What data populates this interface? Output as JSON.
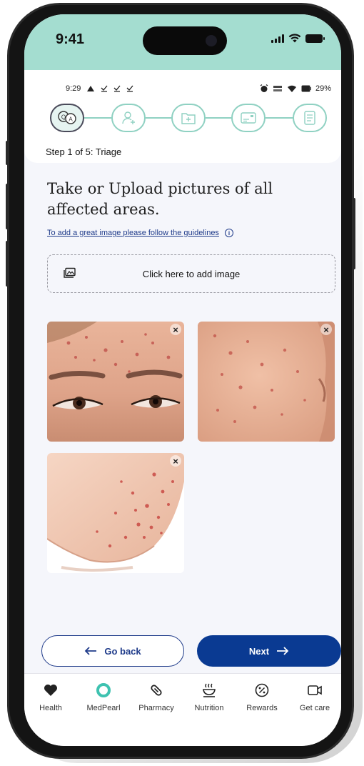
{
  "device": {
    "time": "9:41",
    "colors": {
      "status_bar": "#a4ddd0",
      "accent_primary": "#0a3a92",
      "stepper_line": "#8fd1c2"
    }
  },
  "android_status": {
    "time": "9:29",
    "left_icons": [
      "triangle-icon",
      "download-check-icon",
      "download-check-icon",
      "download-check-icon"
    ],
    "right_icons": [
      "alarm-icon",
      "data-speed-icon",
      "wifi-icon",
      "battery-icon"
    ],
    "battery": "29%"
  },
  "stepper": {
    "current": 1,
    "total": 5,
    "label": "Step 1 of 5: Triage",
    "steps": [
      {
        "icon": "chat-triage-icon"
      },
      {
        "icon": "add-person-icon"
      },
      {
        "icon": "medical-folder-icon"
      },
      {
        "icon": "id-card-icon"
      },
      {
        "icon": "document-list-icon"
      }
    ]
  },
  "content": {
    "heading": "Take or Upload pictures of all affected areas.",
    "guidelines_link": "To add a great image please follow the guidelines",
    "upload_label": "Click here to add image",
    "images": [
      {
        "name": "photo-forehead-eyes",
        "close": "×"
      },
      {
        "name": "photo-cheek",
        "close": "×"
      },
      {
        "name": "photo-jaw",
        "close": "×"
      }
    ]
  },
  "actions": {
    "back_label": "Go back",
    "next_label": "Next"
  },
  "tabbar": {
    "items": [
      {
        "label": "Health",
        "icon": "heart-icon"
      },
      {
        "label": "MedPearl",
        "icon": "pearl-icon"
      },
      {
        "label": "Pharmacy",
        "icon": "pill-icon"
      },
      {
        "label": "Nutrition",
        "icon": "bowl-icon"
      },
      {
        "label": "Rewards",
        "icon": "percent-badge-icon"
      },
      {
        "label": "Get care",
        "icon": "video-call-icon"
      }
    ]
  }
}
